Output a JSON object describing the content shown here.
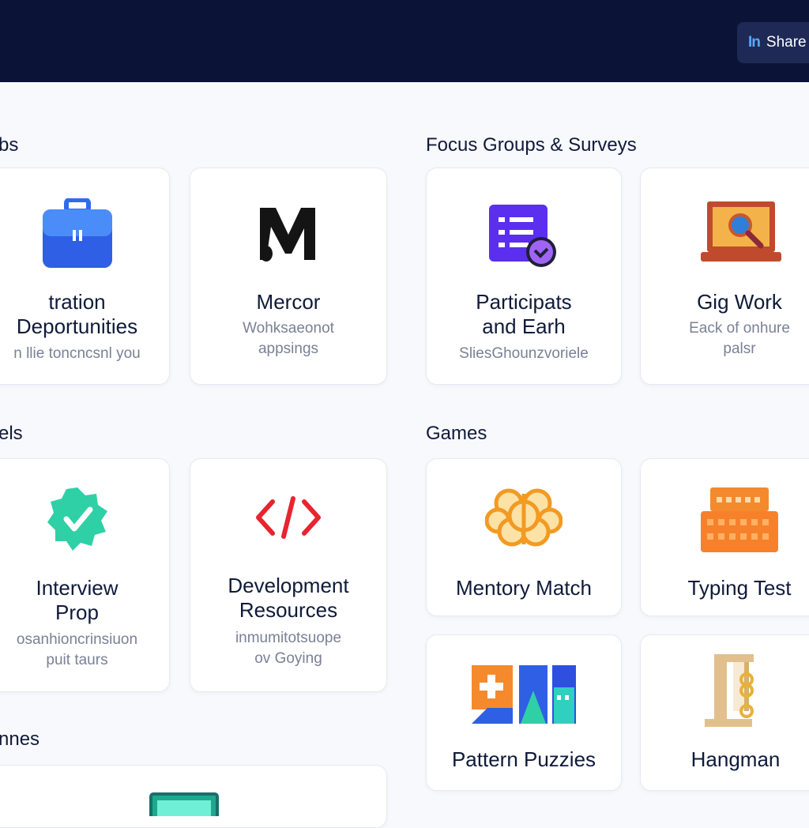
{
  "header": {
    "share_label": "Share",
    "share_logo": "In"
  },
  "sections": {
    "jobs": "bs",
    "focus": "Focus Groups & Surveys",
    "tools": "els",
    "games": "Games",
    "more": "nnes"
  },
  "cards": {
    "registration": {
      "title": "tration\nDeportunities",
      "desc": "n llie toncncsnl you",
      "icon": "briefcase-icon"
    },
    "mercor": {
      "title": "Mercor",
      "desc": "Wohksaeonot\nappsings",
      "icon": "mercor-logo-icon"
    },
    "participants": {
      "title": "Participats\nand Earh",
      "desc": "SliesGhounzvoriele",
      "icon": "survey-list-icon"
    },
    "gigwork": {
      "title": "Gig Work",
      "desc": "Eack of onhure\npalsr",
      "icon": "laptop-search-icon"
    },
    "interview": {
      "title": "Interview\nProp",
      "desc": "osanhioncrinsiuon\npuit taurs",
      "icon": "verified-badge-icon"
    },
    "development": {
      "title": "Development\nResources",
      "desc": "inmumitotsuope\nov Goying",
      "icon": "code-icon"
    },
    "memory": {
      "title": "Mentory Match",
      "icon": "brain-icon"
    },
    "typing": {
      "title": "Typing Test",
      "icon": "keyboard-icon"
    },
    "pattern": {
      "title": "Pattern Puzzies",
      "icon": "puzzle-blocks-icon"
    },
    "hangman": {
      "title": "Hangman",
      "icon": "gallows-icon"
    }
  },
  "colors": {
    "header_bg": "#0b1437",
    "accent_blue": "#3b6ef5",
    "accent_purple": "#6a2cf0",
    "accent_teal": "#2dd4a8",
    "accent_red": "#e8242f",
    "accent_orange": "#f7883a"
  }
}
